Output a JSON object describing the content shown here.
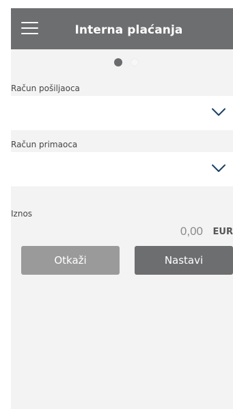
{
  "header": {
    "title": "Interna plaćanja",
    "menu_icon": "hamburger-menu-icon",
    "background_color": "#6d6e70"
  },
  "pager": {
    "pages": 2,
    "current": 1
  },
  "form": {
    "sender_account": {
      "label": "Račun pošiljaoca",
      "value": "",
      "icon": "chevron-down-icon"
    },
    "recipient_account": {
      "label": "Račun primaoca",
      "value": "",
      "icon": "chevron-down-icon"
    },
    "amount": {
      "label": "Iznos",
      "value": "0,00",
      "currency": "EUR"
    }
  },
  "actions": {
    "cancel_label": "Otkaži",
    "continue_label": "Nastavi"
  },
  "colors": {
    "chevron": "#1b3f66",
    "cancel_button": "#9a9a9a",
    "continue_button": "#6d6e70",
    "screen_background": "#f3f3f3"
  }
}
